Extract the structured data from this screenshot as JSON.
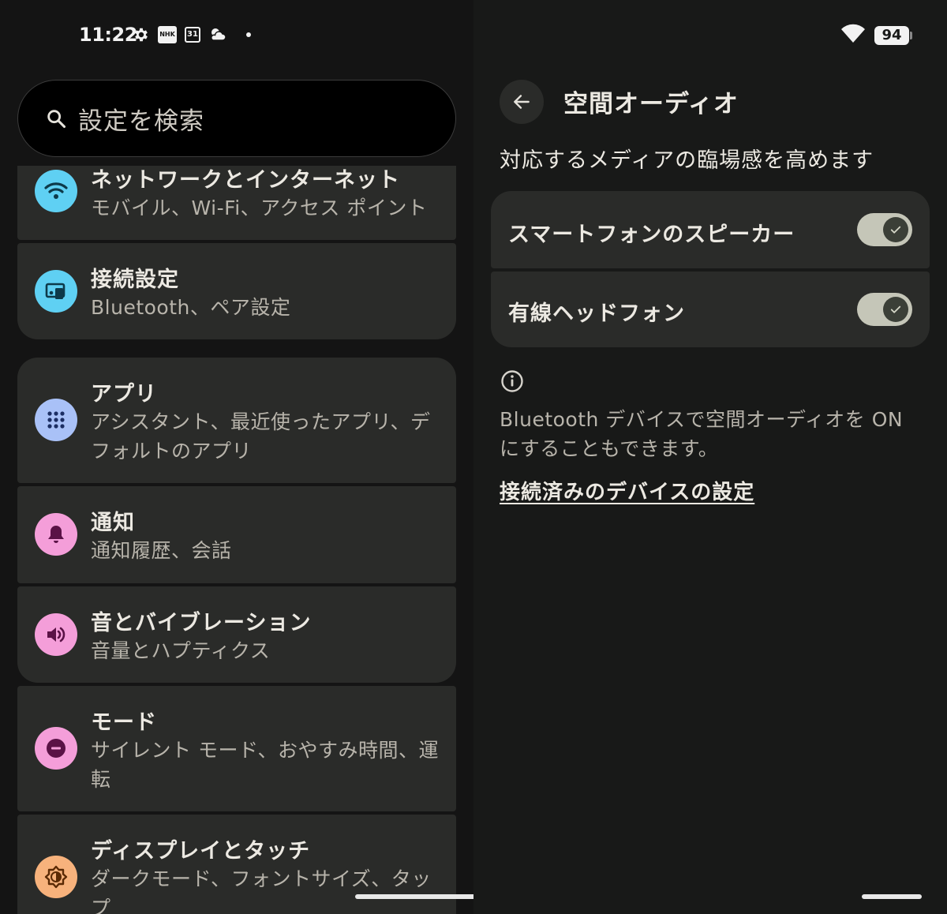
{
  "status_bar": {
    "time": "11:22",
    "nhk_label": "NHK",
    "calendar_day": "31",
    "battery_level": "94",
    "icons": [
      "gear-icon",
      "nhk-icon",
      "calendar-icon",
      "weather-icon",
      "notification-dot",
      "wifi-icon",
      "battery-icon"
    ]
  },
  "search": {
    "placeholder": "設定を検索"
  },
  "settings_list": [
    {
      "id": "network",
      "title": "ネットワークとインターネット",
      "subtitle": "モバイル、Wi-Fi、アクセス ポイント",
      "icon": "wifi-icon",
      "icon_bg": "#5fd0f3"
    },
    {
      "id": "connections",
      "title": "接続設定",
      "subtitle": "Bluetooth、ペア設定",
      "icon": "devices-icon",
      "icon_bg": "#5fd0f3"
    },
    {
      "id": "apps",
      "title": "アプリ",
      "subtitle": "アシスタント、最近使ったアプリ、デフォルトのアプリ",
      "icon": "apps-grid-icon",
      "icon_bg": "#a9c1f7"
    },
    {
      "id": "notifications",
      "title": "通知",
      "subtitle": "通知履歴、会話",
      "icon": "bell-icon",
      "icon_bg": "#f49ed9"
    },
    {
      "id": "sound",
      "title": "音とバイブレーション",
      "subtitle": "音量とハプティクス",
      "icon": "volume-icon",
      "icon_bg": "#f49ed9"
    },
    {
      "id": "modes",
      "title": "モード",
      "subtitle": "サイレント モード、おやすみ時間、運転",
      "icon": "minus-circle-icon",
      "icon_bg": "#f49ed9"
    },
    {
      "id": "display",
      "title": "ディスプレイとタッチ",
      "subtitle": "ダークモード、フォントサイズ、タップ",
      "icon": "brightness-icon",
      "icon_bg": "#f7b27c"
    }
  ],
  "detail": {
    "title": "空間オーディオ",
    "description": "対応するメディアの臨場感を高めます",
    "toggles": [
      {
        "label": "スマートフォンのスピーカー",
        "on": true
      },
      {
        "label": "有線ヘッドフォン",
        "on": true
      }
    ],
    "info_text": "Bluetooth デバイスで空間オーディオを ON にすることもできます。",
    "link_text": "接続済みのデバイスの設定"
  },
  "colors": {
    "background": "#141414",
    "card": "#2a2b29",
    "switch_track": "#c5c6b8",
    "switch_knob": "#3b3f37"
  }
}
